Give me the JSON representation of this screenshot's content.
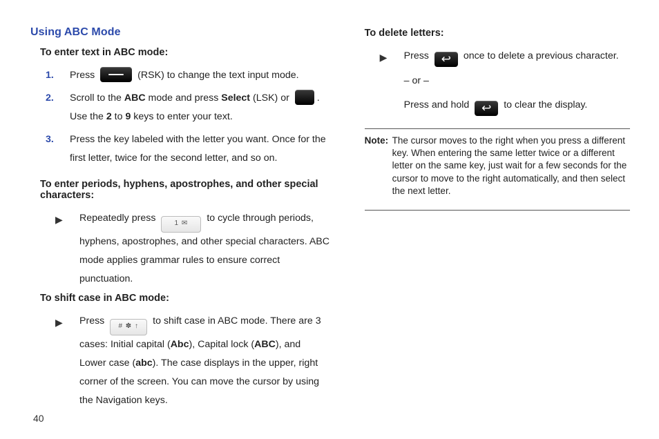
{
  "page_number": "40",
  "left": {
    "title": "Using ABC Mode",
    "s1_head": "To enter text in ABC mode:",
    "steps": {
      "n1": "1.",
      "t1a": "Press ",
      "t1b": " (RSK) to change the text input mode.",
      "n2": "2.",
      "t2a": "Scroll to the ",
      "abc": "ABC",
      "t2b": " mode and press ",
      "select": "Select",
      "t2c": " (LSK) or ",
      "t2d": ". Use the ",
      "two": "2",
      "t2e": " to ",
      "nine": "9",
      "t2f": " keys to enter your text.",
      "n3": "3.",
      "t3": "Press the key labeled with the letter you want. Once for the first letter, twice for the second letter, and so on."
    },
    "s2_head": "To enter periods, hyphens, apostrophes, and other special characters:",
    "s2": {
      "a": "Repeatedly press ",
      "b": " to cycle through periods, hyphens, apostrophes, and other special characters. ABC mode applies grammar rules to ensure correct punctuation."
    },
    "s3_head": "To shift case in ABC mode:",
    "s3": {
      "a": "Press ",
      "b": " to shift case in ABC mode. There are 3 cases: Initial capital (",
      "abc_init": "Abc",
      "c": "), Capital lock (",
      "abc_caps": "ABC",
      "d": "), and Lower case (",
      "abc_low": "abc",
      "e": "). The case displays in the upper, right corner of the screen. You can move the cursor by using the Navigation keys."
    },
    "key_1sym": "1 ✉",
    "key_hash": "# ✽ ↑"
  },
  "right": {
    "head": "To delete letters:",
    "a": "Press ",
    "b": " once to delete a previous character.",
    "or": "– or –",
    "c": "Press and hold ",
    "d": " to clear the display.",
    "note_label": "Note:",
    "note_text": "The cursor moves to the right when you press a different key. When entering the same letter twice or a different letter on the same key, just wait for a few seconds for the cursor to move to the right automatically, and then select the next letter.",
    "back_glyph": "↩"
  }
}
